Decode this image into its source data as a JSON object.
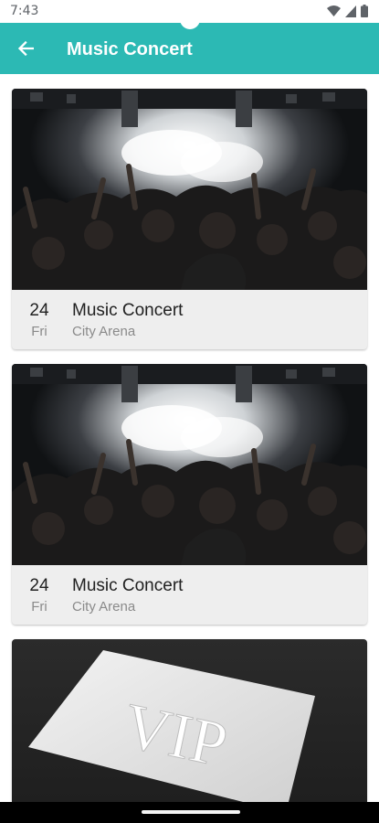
{
  "status_bar": {
    "time": "7:43",
    "icons": [
      "wifi-icon",
      "signal-icon",
      "battery-icon"
    ]
  },
  "app_bar": {
    "title": "Music Concert",
    "back_icon": "arrow-back-icon",
    "color": "#2cb9b4"
  },
  "events": [
    {
      "day": "24",
      "weekday": "Fri",
      "title": "Music Concert",
      "venue": "City Arena",
      "image": "concert-crowd-image"
    },
    {
      "day": "24",
      "weekday": "Fri",
      "title": "Music Concert",
      "venue": "City Arena",
      "image": "concert-crowd-image"
    },
    {
      "image": "vip-ticket-image",
      "image_text": "VIP"
    }
  ]
}
